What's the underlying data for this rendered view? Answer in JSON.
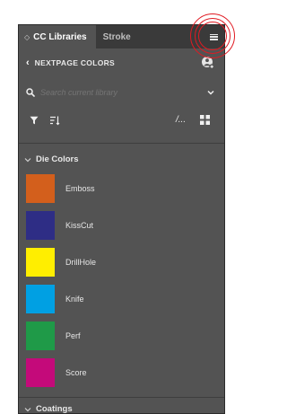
{
  "tabs": [
    {
      "label": "CC Libraries",
      "active": true
    },
    {
      "label": "Stroke",
      "active": false
    }
  ],
  "icons": {
    "tab_grip": "◇",
    "menu": "hamburger-menu-icon",
    "back": "chevron-left-icon",
    "cloud": "cloud-people-icon",
    "search": "search-icon",
    "dropdown": "chevron-down-icon",
    "filter": "filter-icon",
    "sort": "sort-icon",
    "list_view": "list-view-icon",
    "grid_view": "grid-view-icon",
    "section_caret": "chevron-down-icon"
  },
  "library": {
    "back_glyph": "‹",
    "name": "NEXTPAGE COLORS"
  },
  "search": {
    "placeholder": "Search current library"
  },
  "toolbar": {
    "list_view_glyph": "/...",
    "grid_view_glyph": "▪▪"
  },
  "sections": [
    {
      "title": "Die Colors",
      "expanded": true,
      "items": [
        {
          "name": "Emboss",
          "color": "#d35f1c"
        },
        {
          "name": "KissCut",
          "color": "#2e2d85"
        },
        {
          "name": "DrillHole",
          "color": "#ffee00"
        },
        {
          "name": "Knife",
          "color": "#00a0e3"
        },
        {
          "name": "Perf",
          "color": "#1f9a48"
        },
        {
          "name": "Score",
          "color": "#c40a7a"
        }
      ]
    },
    {
      "title": "Coatings",
      "expanded": true,
      "items": []
    }
  ],
  "colors": {
    "panel_bg": "#535353",
    "tabbar_bg": "#3a3a3a",
    "highlight_ring": "#e01a22"
  }
}
